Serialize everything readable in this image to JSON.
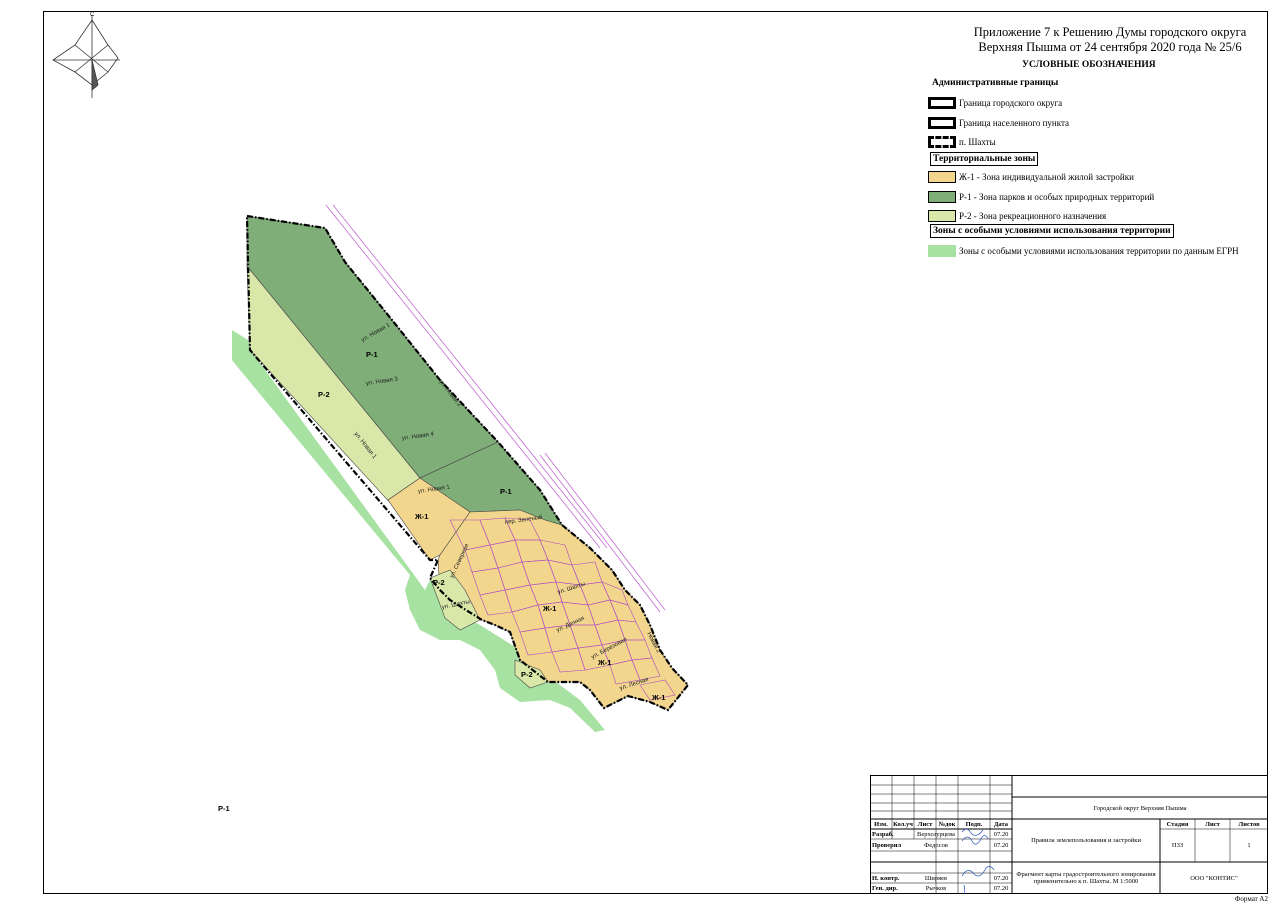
{
  "title": {
    "line1": "Приложение 7 к Решению Думы городского округа",
    "line2": "Верхняя Пышма от 24 сентября 2020 года № 25/6"
  },
  "legend": {
    "heading": "УСЛОВНЫЕ ОБОЗНАЧЕНИЯ",
    "admin_heading": "Административные границы",
    "admin_items": [
      {
        "label": "Граница городского округа"
      },
      {
        "label": "Граница населенного пункта"
      },
      {
        "label": "п. Шахты"
      }
    ],
    "zones_heading": "Территориальные зоны",
    "zone_items": [
      {
        "label": "Ж-1 - Зона индивидуальной жилой застройки",
        "color": "#f2d68e"
      },
      {
        "label": "Р-1 - Зона парков и особых природных территорий",
        "color": "#7fae78"
      },
      {
        "label": "Р-2 - Зона рекреационного назначения",
        "color": "#d9e7a9"
      }
    ],
    "special_heading": "Зоны с особыми условиями использования территории",
    "special_items": [
      {
        "label": "Зоны с особыми условиями использования территории по данным ЕГРН",
        "color": "#a8e2a2"
      }
    ]
  },
  "map": {
    "compass_letter": "С",
    "zone_labels": {
      "r1_north": "Р-1",
      "r2_west": "Р-2",
      "r1_east": "Р-1",
      "zh1_north": "Ж-1",
      "r2_small1": "Р-2",
      "zh1_center": "Ж-1",
      "zh1_south": "Ж-1",
      "r2_small2": "Р-2",
      "zh1_tip": "Ж-1",
      "r1_outside": "Р-1"
    },
    "streets": {
      "s1": "ул. Новая 1",
      "s2": "ул. Новая 2",
      "s3": "ул. Новая 3",
      "s4": "ул. Новая 4",
      "s5": "ул. Новая 1",
      "s6": "ул. Новая 1",
      "s7": "пер. Зеленый",
      "s8": "ул. Северная",
      "s9": "ул. Шахты",
      "s10": "ул. Шахты",
      "s11": "ул. Дачная",
      "s12": "ул. Березовая",
      "s13": "ул. Лесная",
      "s14": "Новая 2"
    },
    "colors": {
      "zh1": "#f2d68e",
      "r1": "#7fae78",
      "r2": "#d9e7a9",
      "egrn": "#a8e2a2",
      "parcel": "#b04bc0"
    }
  },
  "stamp": {
    "hdr_izm": "Изм.",
    "hdr_koluch": "Кол.уч",
    "hdr_list": "Лист",
    "hdr_ndok": "№док",
    "hdr_podp": "Подп.",
    "hdr_data": "Дата",
    "role_razrab": "Разраб.",
    "name_razrab": "Верхозурцева",
    "date_razrab": "07.20",
    "role_proveril": "Проверил",
    "name_proveril": "Федосов",
    "date_proveril": "07.20",
    "role_nkontr": "Н. контр.",
    "name_nkontr": "Ширяев",
    "date_nkontr": "07.20",
    "role_gendir": "Ген. дир.",
    "name_gendir": "Рычков",
    "date_gendir": "07.20",
    "org_title": "Городской округ Верхняя Пышма",
    "project_title": "Правила землепользования и застройки",
    "hdr_stadiya": "Стадия",
    "hdr_list2": "Лист",
    "hdr_listov": "Листов",
    "val_stadiya": "ПЗЗ",
    "val_list": "",
    "val_listov": "1",
    "sheet_title": "Фрагмент карты градостроительного зонирования применительно к п. Шахты. М 1:5000",
    "company": "ООО \"КОНТИС\""
  },
  "format_label": "Формат  А2"
}
